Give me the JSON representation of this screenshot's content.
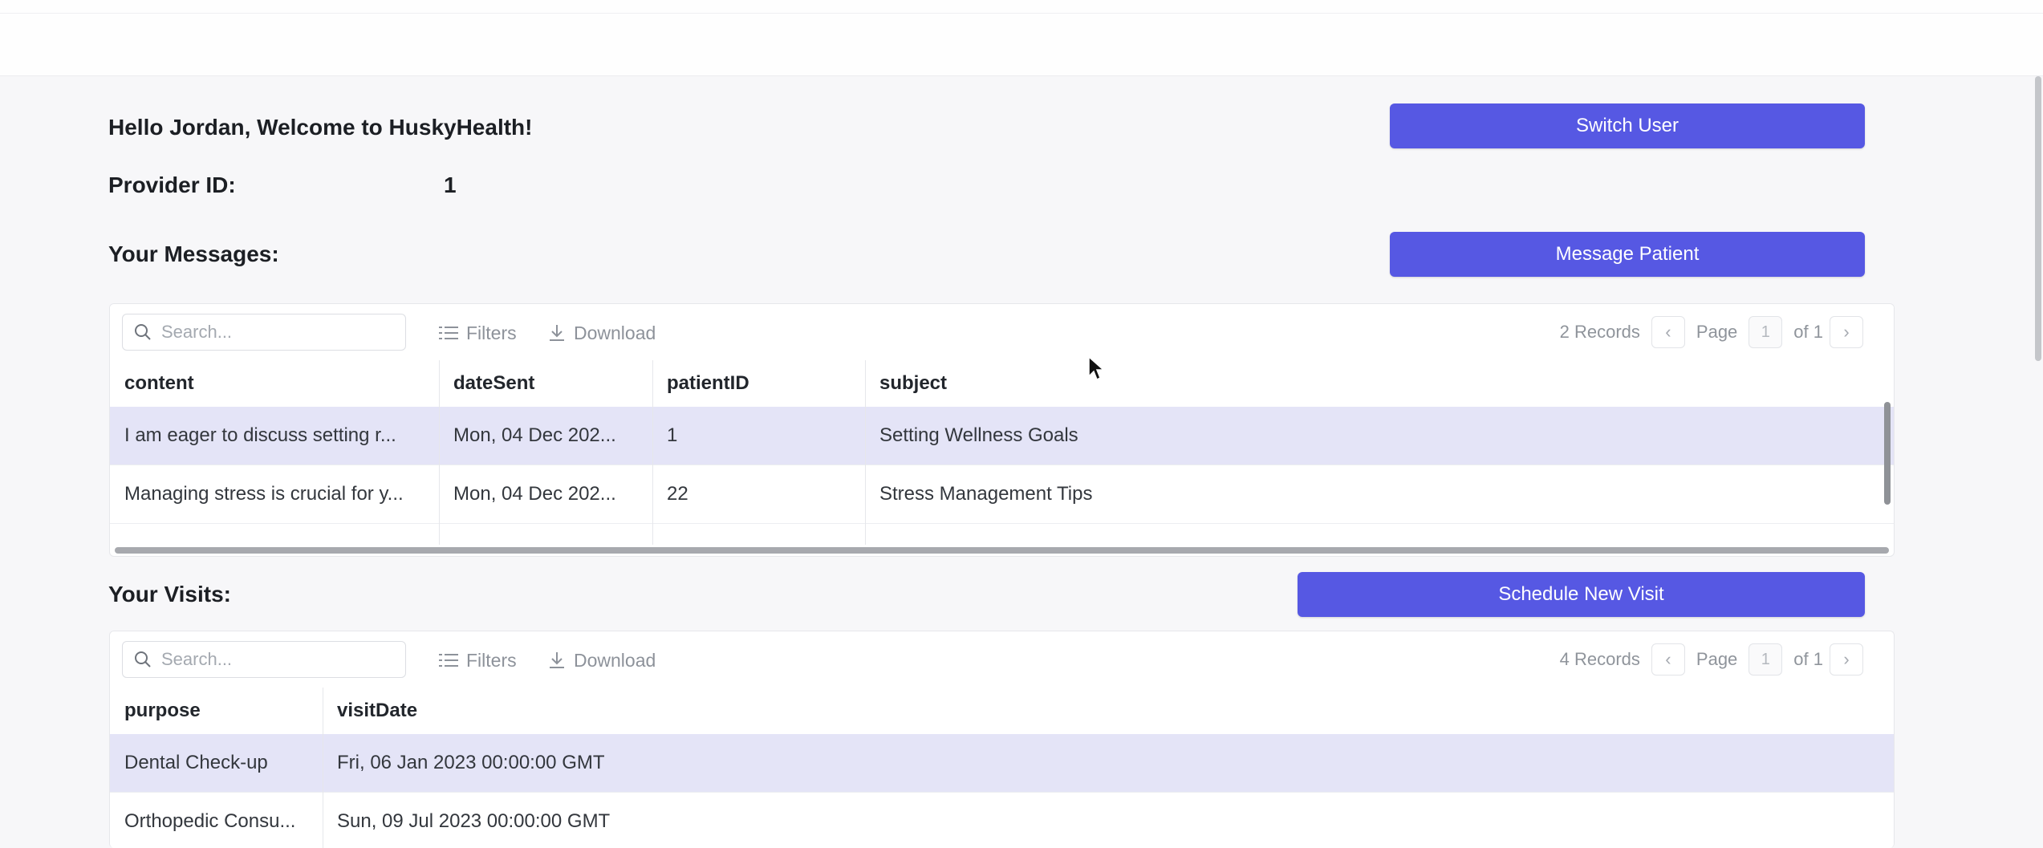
{
  "greeting": "Hello Jordan, Welcome to HuskyHealth!",
  "provider": {
    "label": "Provider ID:",
    "value": "1"
  },
  "buttons": {
    "switch_user": "Switch User",
    "message_patient": "Message Patient",
    "schedule_visit": "Schedule New Visit"
  },
  "messages": {
    "title": "Your Messages:",
    "search_placeholder": "Search...",
    "filters": "Filters",
    "download": "Download",
    "records": "2 Records",
    "page_label": "Page",
    "page_num": "1",
    "page_of": "of 1",
    "columns": [
      "content",
      "dateSent",
      "patientID",
      "subject"
    ],
    "rows": [
      [
        "I am eager to discuss setting r...",
        "Mon, 04 Dec 202...",
        "1",
        "Setting Wellness Goals"
      ],
      [
        "Managing stress is crucial for y...",
        "Mon, 04 Dec 202...",
        "22",
        "Stress Management Tips"
      ]
    ]
  },
  "visits": {
    "title": "Your Visits:",
    "search_placeholder": "Search...",
    "filters": "Filters",
    "download": "Download",
    "records": "4 Records",
    "page_label": "Page",
    "page_num": "1",
    "page_of": "of 1",
    "columns": [
      "purpose",
      "visitDate"
    ],
    "rows": [
      [
        "Dental Check-up",
        "Fri, 06 Jan 2023 00:00:00 GMT"
      ],
      [
        "Orthopedic Consu...",
        "Sun, 09 Jul 2023 00:00:00 GMT"
      ]
    ]
  },
  "colors": {
    "accent": "#5658e3",
    "selected_row": "#e4e4f7"
  }
}
